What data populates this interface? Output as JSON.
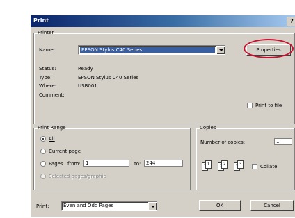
{
  "window": {
    "title": "Print",
    "help_glyph": "?"
  },
  "printer": {
    "group_label": "Printer",
    "name_label": "Name:",
    "name_value": "EPSON Stylus C40 Series",
    "properties_label": "Properties",
    "status_label": "Status:",
    "status_value": "Ready",
    "type_label": "Type:",
    "type_value": "EPSON Stylus C40 Series",
    "where_label": "Where:",
    "where_value": "USB001",
    "comment_label": "Comment:",
    "print_to_file_label": "Print to file"
  },
  "print_range": {
    "group_label": "Print Range",
    "all_label": "All",
    "current_page_label": "Current page",
    "pages_label": "Pages",
    "from_label": "from:",
    "from_value": "1",
    "to_label": "to:",
    "to_value": "244",
    "selected_label": "Selected pages/graphic",
    "selected_option": "all"
  },
  "copies": {
    "group_label": "Copies",
    "number_label": "Number of copies:",
    "number_value": "1",
    "collate_label": "Collate",
    "pages": [
      "1",
      "1",
      "2",
      "2",
      "3",
      "3"
    ]
  },
  "footer": {
    "print_label": "Print:",
    "print_value": "Even and Odd Pages",
    "ok_label": "OK",
    "cancel_label": "Cancel"
  },
  "colors": {
    "annotation": "#c8102e",
    "title_start": "#0a246a",
    "dialog": "#d4d0c8"
  }
}
